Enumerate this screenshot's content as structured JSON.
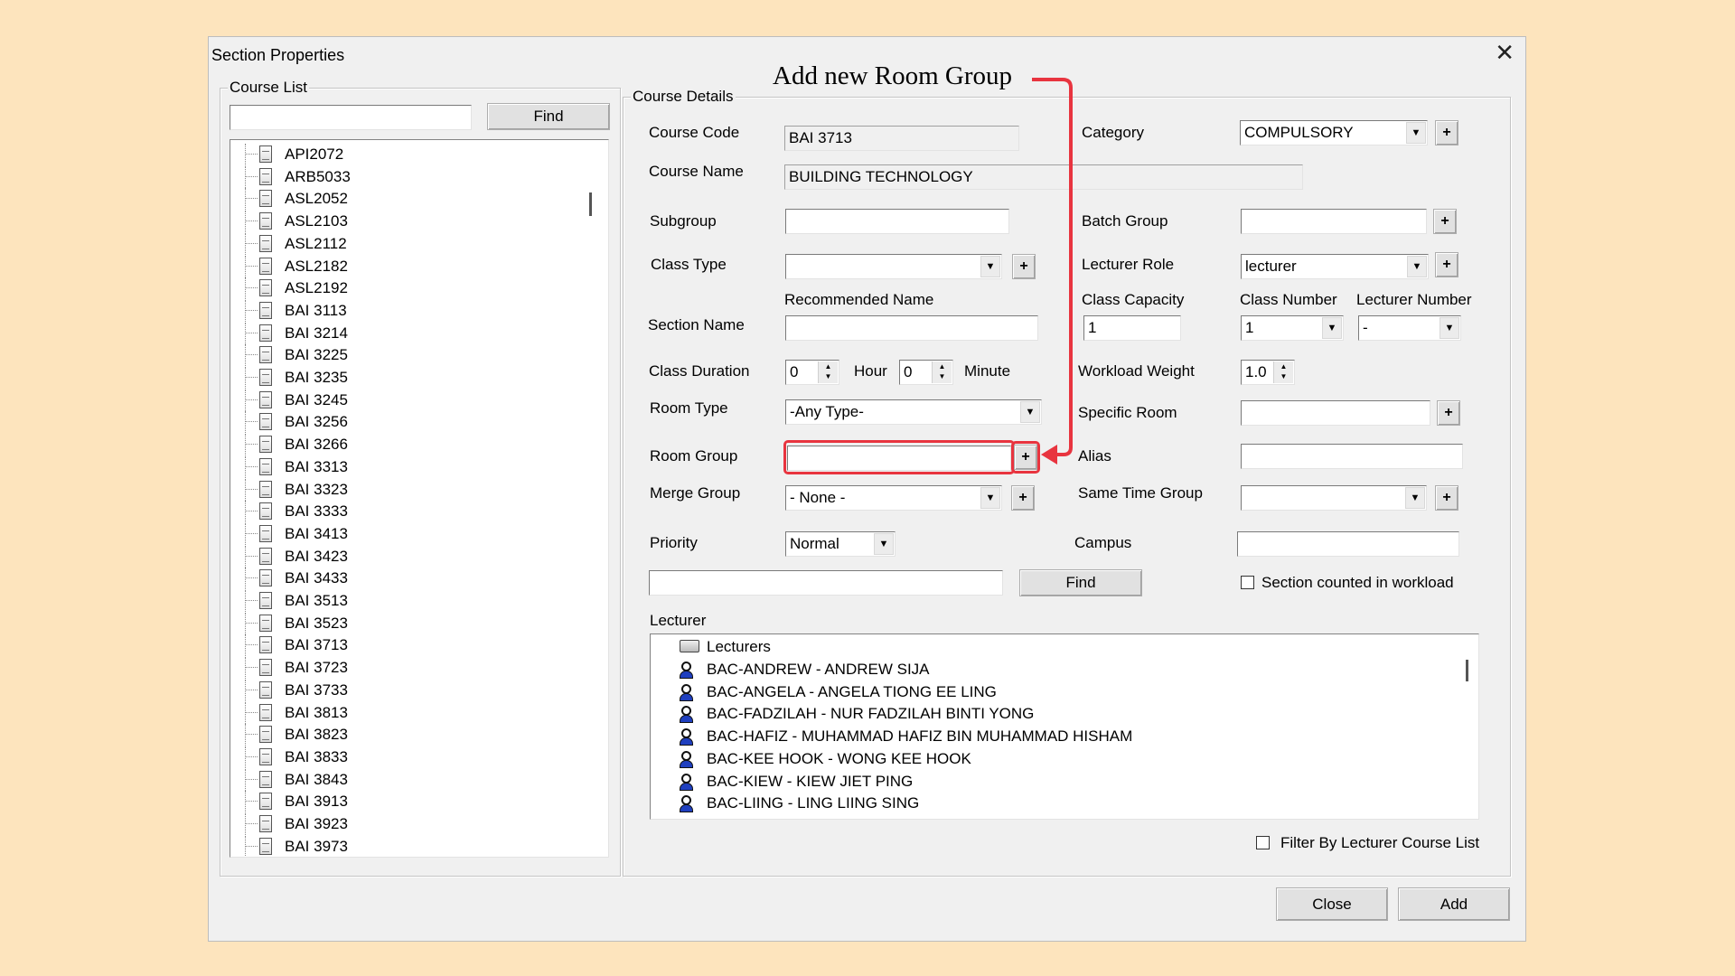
{
  "window": {
    "title": "Section Properties",
    "close_glyph": "✕"
  },
  "annotation": {
    "text": "Add new Room Group",
    "color": "#e8343f"
  },
  "course_list": {
    "legend": "Course List",
    "search_value": "",
    "find_label": "Find",
    "items": [
      "API2072",
      "ARB5033",
      "ASL2052",
      "ASL2103",
      "ASL2112",
      "ASL2182",
      "ASL2192",
      "BAI 3113",
      "BAI 3214",
      "BAI 3225",
      "BAI 3235",
      "BAI 3245",
      "BAI 3256",
      "BAI 3266",
      "BAI 3313",
      "BAI 3323",
      "BAI 3333",
      "BAI 3413",
      "BAI 3423",
      "BAI 3433",
      "BAI 3513",
      "BAI 3523",
      "BAI 3713",
      "BAI 3723",
      "BAI 3733",
      "BAI 3813",
      "BAI 3823",
      "BAI 3833",
      "BAI 3843",
      "BAI 3913",
      "BAI 3923",
      "BAI 3973"
    ]
  },
  "details": {
    "legend": "Course Details",
    "course_code_label": "Course Code",
    "course_code": "BAI 3713",
    "course_name_label": "Course Name",
    "course_name": "BUILDING TECHNOLOGY",
    "category_label": "Category",
    "category": "COMPULSORY",
    "subgroup_label": "Subgroup",
    "subgroup": "",
    "batch_group_label": "Batch Group",
    "batch_group": "",
    "class_type_label": "Class Type",
    "class_type": "",
    "lecturer_role_label": "Lecturer Role",
    "lecturer_role": "lecturer",
    "recommended_name_label": "Recommended Name",
    "class_capacity_label": "Class Capacity",
    "class_capacity": "1",
    "class_number_label": "Class Number",
    "class_number": "1",
    "lecturer_number_label": "Lecturer Number",
    "lecturer_number": "-",
    "section_name_label": "Section Name",
    "section_name": "",
    "class_duration_label": "Class Duration",
    "duration_hours": "0",
    "hour_label": "Hour",
    "duration_minutes": "0",
    "minute_label": "Minute",
    "workload_weight_label": "Workload Weight",
    "workload_weight": "1.0",
    "room_type_label": "Room Type",
    "room_type": "-Any Type-",
    "specific_room_label": "Specific Room",
    "specific_room": "",
    "room_group_label": "Room Group",
    "room_group": "",
    "alias_label": "Alias",
    "alias": "",
    "merge_group_label": "Merge Group",
    "merge_group": "- None -",
    "same_time_group_label": "Same Time Group",
    "same_time_group": "",
    "priority_label": "Priority",
    "priority": "Normal",
    "campus_label": "Campus",
    "campus": "",
    "lecturer_search": "",
    "find_label": "Find",
    "section_counted_label": "Section counted in workload",
    "plus_glyph": "+",
    "dropdown_glyph": "▼",
    "spin_up": "▲",
    "spin_down": "▼"
  },
  "lecturer": {
    "label": "Lecturer",
    "root": "Lecturers",
    "items": [
      "BAC-ANDREW - ANDREW SIJA",
      "BAC-ANGELA - ANGELA TIONG EE LING",
      "BAC-FADZILAH - NUR FADZILAH BINTI YONG",
      "BAC-HAFIZ - MUHAMMAD HAFIZ BIN MUHAMMAD HISHAM",
      "BAC-KEE HOOK - WONG KEE HOOK",
      "BAC-KIEW - KIEW JIET PING",
      "BAC-LIING - LING LIING SING"
    ],
    "filter_label": "Filter By Lecturer Course List"
  },
  "footer": {
    "close_label": "Close",
    "add_label": "Add"
  }
}
